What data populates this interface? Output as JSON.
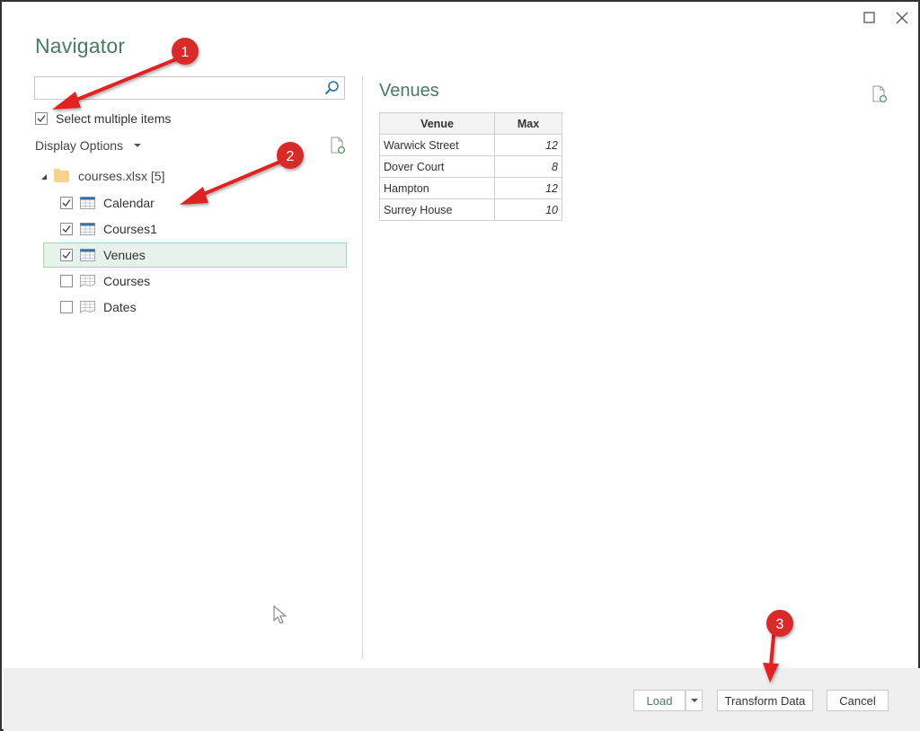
{
  "window": {
    "title": "Navigator",
    "maximize_icon": "maximize-icon",
    "close_icon": "close-icon"
  },
  "left_panel": {
    "search": {
      "value": "",
      "placeholder": ""
    },
    "select_multiple": {
      "label": "Select multiple items",
      "checked": true
    },
    "display_options": {
      "label": "Display Options"
    },
    "tree": {
      "root": {
        "label": "courses.xlsx [5]",
        "expanded": true,
        "icon": "folder-icon"
      },
      "items": [
        {
          "label": "Calendar",
          "checked": true,
          "icon": "table-icon",
          "selected": false
        },
        {
          "label": "Courses1",
          "checked": true,
          "icon": "table-icon",
          "selected": false
        },
        {
          "label": "Venues",
          "checked": true,
          "icon": "table-icon",
          "selected": true
        },
        {
          "label": "Courses",
          "checked": false,
          "icon": "sheet-icon",
          "selected": false
        },
        {
          "label": "Dates",
          "checked": false,
          "icon": "sheet-icon",
          "selected": false
        }
      ]
    }
  },
  "preview": {
    "title": "Venues",
    "columns": [
      "Venue",
      "Max"
    ],
    "rows": [
      [
        "Warwick Street",
        "12"
      ],
      [
        "Dover Court",
        "8"
      ],
      [
        "Hampton",
        "12"
      ],
      [
        "Surrey House",
        "10"
      ]
    ]
  },
  "footer": {
    "load_label": "Load",
    "transform_label": "Transform Data",
    "cancel_label": "Cancel"
  },
  "annotations": {
    "badges": [
      "1",
      "2",
      "3"
    ],
    "color": "#e02020"
  },
  "colors": {
    "accent": "#4b7a5f",
    "selected_bg": "#e6f2ea",
    "selected_border": "#a9d4b8",
    "footer_bg": "#efefef"
  }
}
